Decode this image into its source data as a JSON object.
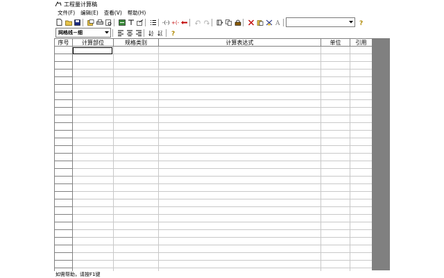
{
  "window": {
    "title": "工程量计算稿"
  },
  "menu": [
    {
      "label": "文件(F)"
    },
    {
      "label": "编辑(E)"
    },
    {
      "label": "查看(V)"
    },
    {
      "label": "帮助(H)"
    }
  ],
  "toolbar1": {
    "icons": [
      "new-file-icon",
      "open-folder-icon",
      "save-icon",
      "sep",
      "copy-page-icon",
      "print-icon",
      "print-preview-icon",
      "sep",
      "insert-row-icon",
      "sort-icon",
      "export-icon",
      "sep",
      "list-icon",
      "sep",
      "bracket-icon",
      "bracket-red-icon",
      "arrow-left-icon",
      "sep",
      "undo-icon",
      "redo-icon",
      "sep",
      "calc-icon",
      "copy-icon",
      "lock-icon",
      "sep",
      "delete-icon",
      "paste-icon",
      "cut-icon",
      "font-icon"
    ],
    "help_icon": "help-icon"
  },
  "toolbar2": {
    "line_style": "网格线－细",
    "icons": [
      "align-left-icon",
      "align-center-icon",
      "align-right-icon",
      "sep",
      "sort-asc-icon",
      "sort-desc-icon",
      "sep",
      "help-icon"
    ]
  },
  "table": {
    "columns": [
      "序号",
      "计算部位",
      "规格类别",
      "计算表达式",
      "单位",
      "引用"
    ],
    "row_count": 30
  },
  "status": {
    "text": "如需帮助，请按F1键"
  },
  "colors": {
    "grid_line": "#c8c8c8",
    "panel": "#808080"
  }
}
